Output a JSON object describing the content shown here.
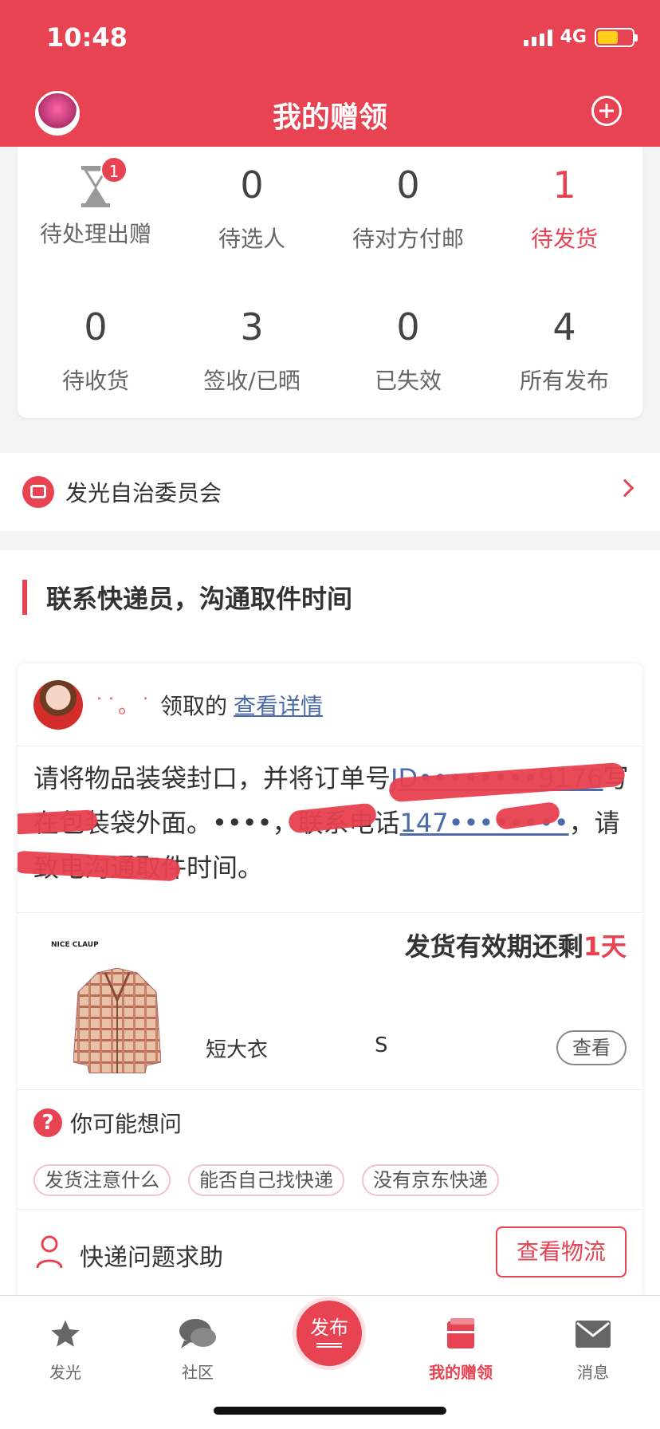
{
  "status_bar": {
    "time": "10:48",
    "network": "4G"
  },
  "header": {
    "title": "我的赠领"
  },
  "stats": {
    "row1": [
      {
        "label": "待处理出赠",
        "badge": "1",
        "icon": "hourglass-icon"
      },
      {
        "value": "0",
        "label": "待选人"
      },
      {
        "value": "0",
        "label": "待对方付邮"
      },
      {
        "value": "1",
        "label": "待发货"
      }
    ],
    "row2": [
      {
        "value": "0",
        "label": "待收货"
      },
      {
        "value": "3",
        "label": "签收/已晒"
      },
      {
        "value": "0",
        "label": "已失效"
      },
      {
        "value": "4",
        "label": "所有发布"
      }
    ]
  },
  "committee": {
    "label": "发光自治委员会"
  },
  "section": {
    "title": "联系快递员，沟通取件时间"
  },
  "order": {
    "claimer_name": "˙˙。˙",
    "claimer_text": "领取的",
    "detail_link": "查看详情",
    "instr_part1": "请将物品装袋封口，并将订单号",
    "order_no_visible": "JD••••••••9176",
    "instr_part2": "写在包装袋外面。",
    "courier_name": "••••",
    "instr_part3": "，联系电话",
    "phone_visible": "147••••••••",
    "instr_part4": "，请致电沟通取件时间。",
    "product_brand": "NICE CLAUP",
    "deadline_prefix": "发货有效期还剩",
    "deadline_value": "1天",
    "product_name": "短大衣",
    "product_size": "S",
    "view_label": "查看"
  },
  "faq": {
    "title": "你可能想问",
    "chips": [
      "发货注意什么",
      "能否自己找快递",
      "没有京东快递"
    ]
  },
  "help": {
    "label": "快递问题求助",
    "logistics_button": "查看物流"
  },
  "tabbar": {
    "items": [
      {
        "label": "发光",
        "icon": "star-icon"
      },
      {
        "label": "社区",
        "icon": "chat-icon"
      },
      {
        "label": "发布",
        "icon": "publish-icon"
      },
      {
        "label": "我的赠领",
        "icon": "gift-icon"
      },
      {
        "label": "消息",
        "icon": "mail-icon"
      }
    ]
  },
  "colors": {
    "brand": "#e84353",
    "link": "#4a6aa8",
    "text": "#333333"
  }
}
